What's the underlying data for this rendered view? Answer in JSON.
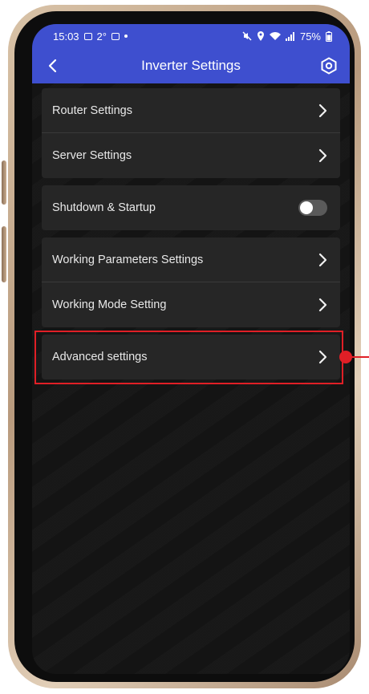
{
  "statusbar": {
    "time": "15:03",
    "temp": "2°",
    "battery": "75%"
  },
  "appbar": {
    "title": "Inverter Settings"
  },
  "groups": [
    {
      "items": [
        {
          "label": "Router Settings"
        },
        {
          "label": "Server Settings"
        }
      ]
    },
    {
      "items": [
        {
          "label": "Shutdown & Startup",
          "toggle_on": false
        }
      ]
    },
    {
      "items": [
        {
          "label": "Working Parameters Settings"
        },
        {
          "label": "Working Mode Setting"
        }
      ]
    },
    {
      "items": [
        {
          "label": "Advanced settings"
        }
      ]
    }
  ],
  "colors": {
    "accent": "#3e4fcf",
    "background": "#141414",
    "row_background": "#262626",
    "highlight": "#e01f26"
  },
  "icons": [
    "back-arrow-icon",
    "gear-settings-icon",
    "chevron-right-icon"
  ]
}
